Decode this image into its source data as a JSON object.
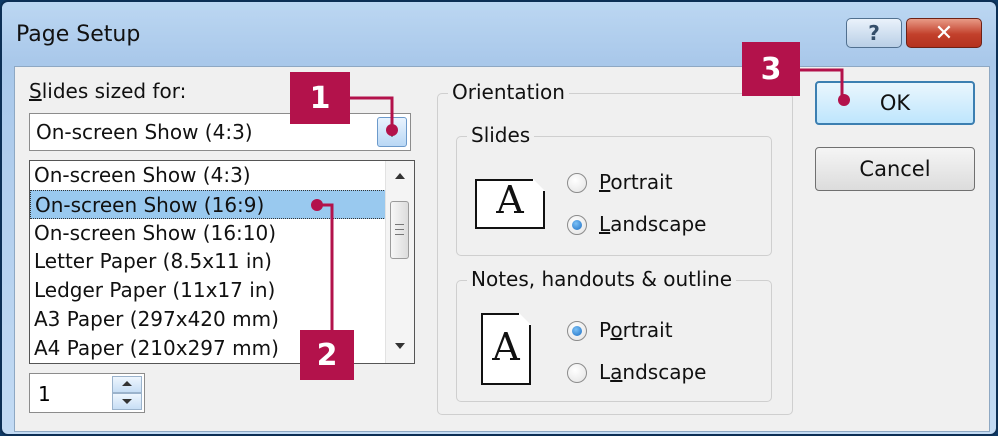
{
  "window": {
    "title": "Page Setup",
    "help_glyph": "?",
    "close_glyph": "✕"
  },
  "slides_sized_for": {
    "label_hotkey": "S",
    "label_rest": "lides sized for:",
    "selected": "On-screen Show (4:3)",
    "options": [
      "On-screen Show (4:3)",
      "On-screen Show (16:9)",
      "On-screen Show (16:10)",
      "Letter Paper (8.5x11 in)",
      "Ledger Paper (11x17 in)",
      "A3 Paper (297x420 mm)",
      "A4 Paper (210x297 mm)"
    ],
    "highlighted_index": 1
  },
  "number_spinner": {
    "value": "1"
  },
  "orientation": {
    "title": "Orientation",
    "slides": {
      "title": "Slides",
      "icon_letter": "A",
      "portrait": {
        "hotkey": "P",
        "rest": "ortrait",
        "selected": false
      },
      "landscape": {
        "hotkey": "L",
        "rest": "andscape",
        "selected": true
      }
    },
    "notes": {
      "title": "Notes, handouts & outline",
      "icon_letter": "A",
      "portrait": {
        "pre": "P",
        "hotkey": "o",
        "rest": "rtrait",
        "selected": true
      },
      "landscape": {
        "pre": "L",
        "hotkey": "a",
        "rest": "ndscape",
        "selected": false
      }
    }
  },
  "buttons": {
    "ok": "OK",
    "cancel": "Cancel"
  },
  "callouts": {
    "one": "1",
    "two": "2",
    "three": "3",
    "color": "#b3124b"
  }
}
